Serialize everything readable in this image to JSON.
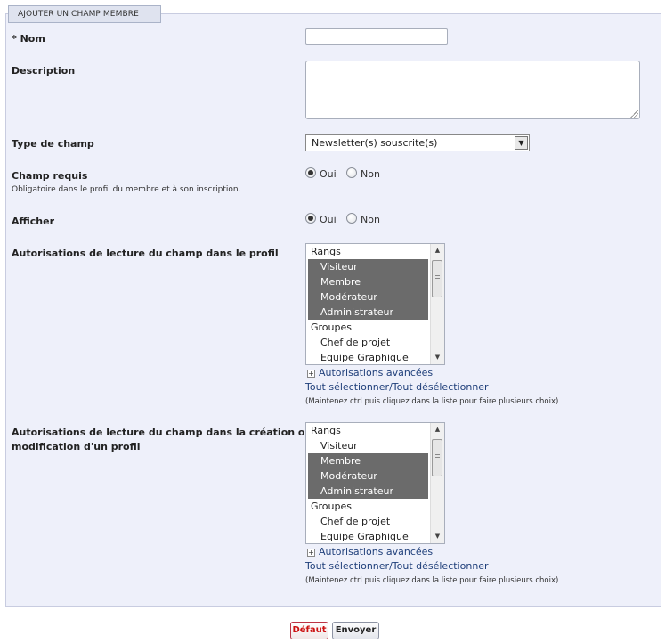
{
  "legend": "AJOUTER UN CHAMP MEMBRE",
  "fields": {
    "name": {
      "label": "* Nom",
      "value": ""
    },
    "description": {
      "label": "Description",
      "value": ""
    },
    "type": {
      "label": "Type de champ",
      "selected": "Newsletter(s) souscrite(s)"
    },
    "required": {
      "label": "Champ requis",
      "sub": "Obligatoire dans le profil du membre et à son inscription.",
      "yes": "Oui",
      "no": "Non",
      "value": "Oui"
    },
    "display": {
      "label": "Afficher",
      "yes": "Oui",
      "no": "Non",
      "value": "Oui"
    }
  },
  "perm_read_profile": {
    "label": "Autorisations de lecture du champ dans le profil",
    "options": [
      {
        "text": "Rangs",
        "group": true,
        "selected": false
      },
      {
        "text": "Visiteur",
        "group": false,
        "selected": true
      },
      {
        "text": "Membre",
        "group": false,
        "selected": true
      },
      {
        "text": "Modérateur",
        "group": false,
        "selected": true
      },
      {
        "text": "Administrateur",
        "group": false,
        "selected": true
      },
      {
        "text": "Groupes",
        "group": true,
        "selected": false
      },
      {
        "text": "Chef de projet",
        "group": false,
        "selected": false
      },
      {
        "text": "Equipe Graphique",
        "group": false,
        "selected": false
      }
    ],
    "advanced": "Autorisations avancées",
    "select_all": "Tout sélectionner/Tout désélectionner",
    "hint": "(Maintenez ctrl puis cliquez dans la liste pour faire plusieurs choix)"
  },
  "perm_edit_profile": {
    "label_line1": "Autorisations de lecture du champ dans la création ou la",
    "label_line2": "modification d'un profil",
    "options": [
      {
        "text": "Rangs",
        "group": true,
        "selected": false
      },
      {
        "text": "Visiteur",
        "group": false,
        "selected": false
      },
      {
        "text": "Membre",
        "group": false,
        "selected": true
      },
      {
        "text": "Modérateur",
        "group": false,
        "selected": true
      },
      {
        "text": "Administrateur",
        "group": false,
        "selected": true
      },
      {
        "text": "Groupes",
        "group": true,
        "selected": false
      },
      {
        "text": "Chef de projet",
        "group": false,
        "selected": false
      },
      {
        "text": "Equipe Graphique",
        "group": false,
        "selected": false
      }
    ],
    "advanced": "Autorisations avancées",
    "select_all": "Tout sélectionner/Tout désélectionner",
    "hint": "(Maintenez ctrl puis cliquez dans la liste pour faire plusieurs choix)"
  },
  "buttons": {
    "default": "Défaut",
    "submit": "Envoyer"
  },
  "colors": {
    "link": "#1f3f7a",
    "selected_option": "#6b6b6b",
    "panel_bg": "#eef0fa",
    "default_button_text": "#cc1111"
  }
}
